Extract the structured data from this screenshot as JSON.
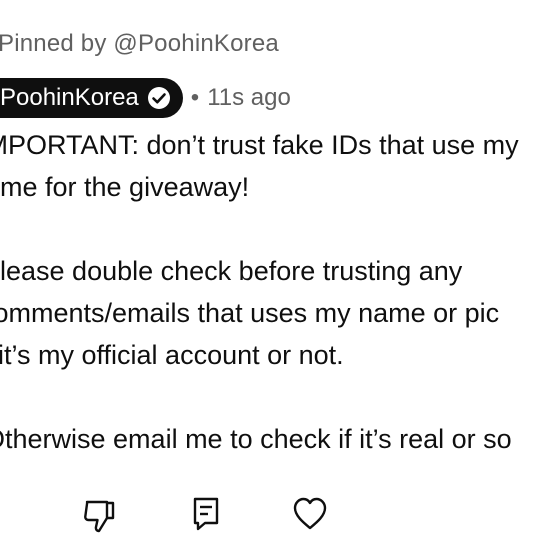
{
  "pinned": {
    "text": "Pinned by @PoohinKorea"
  },
  "comment": {
    "author": "PoohinKorea",
    "separator": "•",
    "time": "11s ago",
    "lines": [
      "IMPORTANT: don’t trust fake IDs that use my",
      "me for the giveaway!",
      "",
      "Please double check before trusting any",
      "comments/emails that uses my name or pic",
      "it’s my official account or not.",
      "",
      "Otherwise email me to check if it’s real or so"
    ]
  },
  "actions": {
    "icons": [
      "thumbs-down-icon",
      "reply-icon",
      "heart-icon"
    ]
  },
  "colors": {
    "text": "#0f0f0f",
    "muted": "#606060",
    "chip_bg": "#0f0f0f",
    "chip_text": "#ffffff",
    "background": "#ffffff"
  }
}
